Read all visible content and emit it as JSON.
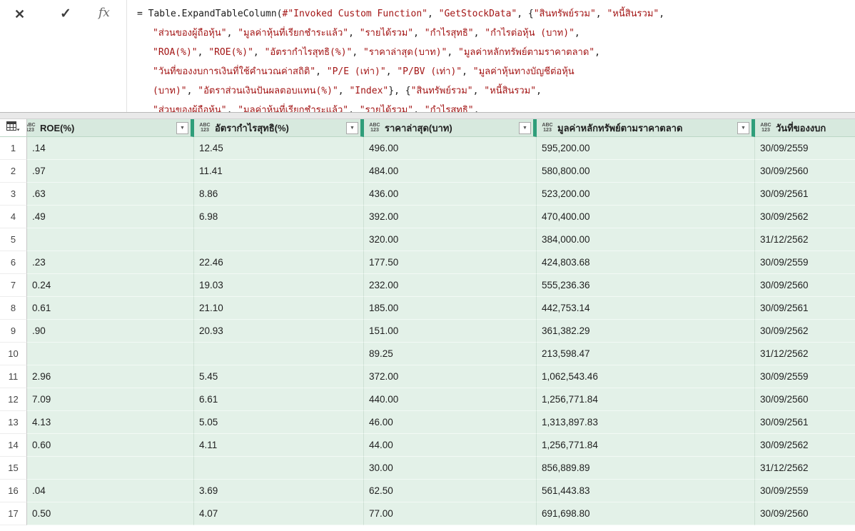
{
  "colors": {
    "accent_green": "#2F9E7A",
    "header_bg": "#D7E9DE",
    "row_bg": "#E3F1E8",
    "formula_string": "#A31515",
    "formula_code": "#1A1A1A"
  },
  "formula_bar": {
    "cancel_icon": "✕",
    "confirm_icon": "✓",
    "fx_label": "fx",
    "lines": [
      [
        {
          "t": "c",
          "x": "= Table.ExpandTableColumn("
        },
        {
          "t": "s",
          "x": "#\"Invoked Custom Function\""
        },
        {
          "t": "c",
          "x": ", "
        },
        {
          "t": "s",
          "x": "\"GetStockData\""
        },
        {
          "t": "c",
          "x": ", {"
        },
        {
          "t": "s",
          "x": "\"สินทรัพย์รวม\""
        },
        {
          "t": "c",
          "x": ", "
        },
        {
          "t": "s",
          "x": "\"หนี้สินรวม\""
        },
        {
          "t": "c",
          "x": ","
        }
      ],
      [
        {
          "t": "s",
          "x": "\"ส่วนของผู้ถือหุ้น\""
        },
        {
          "t": "c",
          "x": ", "
        },
        {
          "t": "s",
          "x": "\"มูลค่าหุ้นที่เรียกชำระแล้ว\""
        },
        {
          "t": "c",
          "x": ", "
        },
        {
          "t": "s",
          "x": "\"รายได้รวม\""
        },
        {
          "t": "c",
          "x": ", "
        },
        {
          "t": "s",
          "x": "\"กำไรสุทธิ\""
        },
        {
          "t": "c",
          "x": ", "
        },
        {
          "t": "s",
          "x": "\"กำไรต่อหุ้น (บาท)\""
        },
        {
          "t": "c",
          "x": ","
        }
      ],
      [
        {
          "t": "s",
          "x": "\"ROA(%)\""
        },
        {
          "t": "c",
          "x": ", "
        },
        {
          "t": "s",
          "x": "\"ROE(%)\""
        },
        {
          "t": "c",
          "x": ", "
        },
        {
          "t": "s",
          "x": "\"อัตรากำไรสุทธิ(%)\""
        },
        {
          "t": "c",
          "x": ", "
        },
        {
          "t": "s",
          "x": "\"ราคาล่าสุด(บาท)\""
        },
        {
          "t": "c",
          "x": ", "
        },
        {
          "t": "s",
          "x": "\"มูลค่าหลักทรัพย์ตามราคาตลาด\""
        },
        {
          "t": "c",
          "x": ","
        }
      ],
      [
        {
          "t": "s",
          "x": "\"วันที่ของงบการเงินที่ใช้คำนวณค่าสถิติ\""
        },
        {
          "t": "c",
          "x": ", "
        },
        {
          "t": "s",
          "x": "\"P/E (เท่า)\""
        },
        {
          "t": "c",
          "x": ", "
        },
        {
          "t": "s",
          "x": "\"P/BV (เท่า)\""
        },
        {
          "t": "c",
          "x": ", "
        },
        {
          "t": "s",
          "x": "\"มูลค่าหุ้นทางบัญชีต่อหุ้น"
        }
      ],
      [
        {
          "t": "s",
          "x": "(บาท)\""
        },
        {
          "t": "c",
          "x": ", "
        },
        {
          "t": "s",
          "x": "\"อัตราส่วนเงินปันผลตอบแทน(%)\""
        },
        {
          "t": "c",
          "x": ", "
        },
        {
          "t": "s",
          "x": "\"Index\""
        },
        {
          "t": "c",
          "x": "}, {"
        },
        {
          "t": "s",
          "x": "\"สินทรัพย์รวม\""
        },
        {
          "t": "c",
          "x": ", "
        },
        {
          "t": "s",
          "x": "\"หนี้สินรวม\""
        },
        {
          "t": "c",
          "x": ","
        }
      ],
      [
        {
          "t": "s",
          "x": "\"ส่วนของผู้ถือหุ้น\""
        },
        {
          "t": "c",
          "x": ", "
        },
        {
          "t": "s",
          "x": "\"มูลค่าหุ้นที่เรียกชำระแล้ว\""
        },
        {
          "t": "c",
          "x": ", "
        },
        {
          "t": "s",
          "x": "\"รายได้รวม\""
        },
        {
          "t": "c",
          "x": ", "
        },
        {
          "t": "s",
          "x": "\"กำไรสุทธิ\""
        },
        {
          "t": "c",
          "x": ","
        }
      ]
    ]
  },
  "grid": {
    "filter_icon": "▼",
    "type_icon_top": "ABC",
    "type_icon_bottom": "123",
    "columns": [
      {
        "name": "ROE(%)",
        "clip_icon": true
      },
      {
        "name": "อัตรากำไรสุทธิ(%)",
        "clip_icon": false
      },
      {
        "name": "ราคาล่าสุด(บาท)",
        "clip_icon": false
      },
      {
        "name": "มูลค่าหลักทรัพย์ตามราคาตลาด",
        "clip_icon": false
      },
      {
        "name": "วันที่ของงบก",
        "clip_icon": false
      }
    ],
    "rows": [
      {
        "num": "1",
        "cells": [
          ".14",
          "12.45",
          "496.00",
          "595,200.00",
          "30/09/2559"
        ]
      },
      {
        "num": "2",
        "cells": [
          ".97",
          "11.41",
          "484.00",
          "580,800.00",
          "30/09/2560"
        ]
      },
      {
        "num": "3",
        "cells": [
          ".63",
          "8.86",
          "436.00",
          "523,200.00",
          "30/09/2561"
        ]
      },
      {
        "num": "4",
        "cells": [
          ".49",
          "6.98",
          "392.00",
          "470,400.00",
          "30/09/2562"
        ]
      },
      {
        "num": "5",
        "cells": [
          "",
          "",
          "320.00",
          "384,000.00",
          "31/12/2562"
        ]
      },
      {
        "num": "6",
        "cells": [
          ".23",
          "22.46",
          "177.50",
          "424,803.68",
          "30/09/2559"
        ]
      },
      {
        "num": "7",
        "cells": [
          "0.24",
          "19.03",
          "232.00",
          "555,236.36",
          "30/09/2560"
        ]
      },
      {
        "num": "8",
        "cells": [
          "0.61",
          "21.10",
          "185.00",
          "442,753.14",
          "30/09/2561"
        ]
      },
      {
        "num": "9",
        "cells": [
          ".90",
          "20.93",
          "151.00",
          "361,382.29",
          "30/09/2562"
        ]
      },
      {
        "num": "10",
        "cells": [
          "",
          "",
          "89.25",
          "213,598.47",
          "31/12/2562"
        ]
      },
      {
        "num": "11",
        "cells": [
          "2.96",
          "5.45",
          "372.00",
          "1,062,543.46",
          "30/09/2559"
        ]
      },
      {
        "num": "12",
        "cells": [
          "7.09",
          "6.61",
          "440.00",
          "1,256,771.84",
          "30/09/2560"
        ]
      },
      {
        "num": "13",
        "cells": [
          "4.13",
          "5.05",
          "46.00",
          "1,313,897.83",
          "30/09/2561"
        ]
      },
      {
        "num": "14",
        "cells": [
          "0.60",
          "4.11",
          "44.00",
          "1,256,771.84",
          "30/09/2562"
        ]
      },
      {
        "num": "15",
        "cells": [
          "",
          "",
          "30.00",
          "856,889.89",
          "31/12/2562"
        ]
      },
      {
        "num": "16",
        "cells": [
          ".04",
          "3.69",
          "62.50",
          "561,443.83",
          "30/09/2559"
        ]
      },
      {
        "num": "17",
        "cells": [
          "0.50",
          "4.07",
          "77.00",
          "691,698.80",
          "30/09/2560"
        ]
      }
    ]
  }
}
